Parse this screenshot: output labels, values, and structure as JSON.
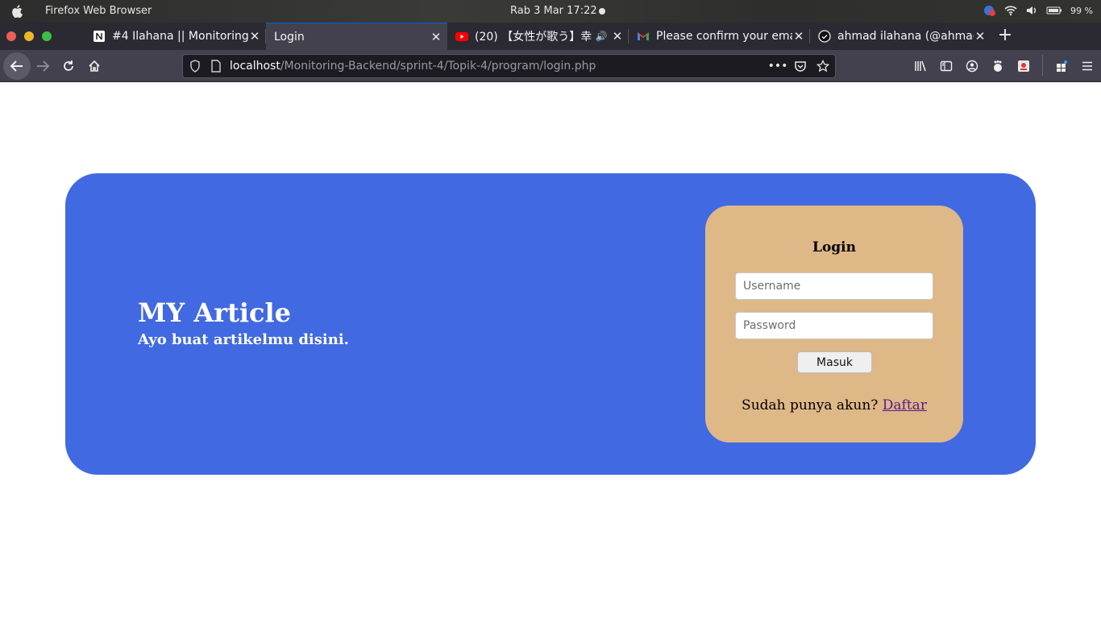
{
  "os_bar": {
    "app_name": "Firefox Web Browser",
    "clock": "Rab  3 Mar   17:22",
    "battery": "99 %"
  },
  "tabs": [
    {
      "title": "#4 Ilahana || Monitoring B",
      "icon": "notion-icon"
    },
    {
      "title": "Login",
      "icon": "",
      "active": true
    },
    {
      "title": "(20) 【女性が歌う】幸",
      "icon": "youtube-icon"
    },
    {
      "title": "Please confirm your ema",
      "icon": "gmail-icon"
    },
    {
      "title": "ahmad ilahana (@ahmad",
      "icon": "github-icon"
    }
  ],
  "urlbar": {
    "host": "localhost",
    "path": "/Monitoring-Backend/sprint-4/Topik-4/program/login.php"
  },
  "hero": {
    "title": "MY Article",
    "subtitle": "Ayo buat artikelmu disini."
  },
  "login": {
    "title": "Login",
    "username_placeholder": "Username",
    "password_placeholder": "Password",
    "submit_label": "Masuk",
    "signup_text": "Sudah punya akun? ",
    "signup_link": "Daftar"
  },
  "colors": {
    "hero_bg": "#4169e1",
    "card_bg": "#deb887",
    "link": "#551a8b"
  }
}
